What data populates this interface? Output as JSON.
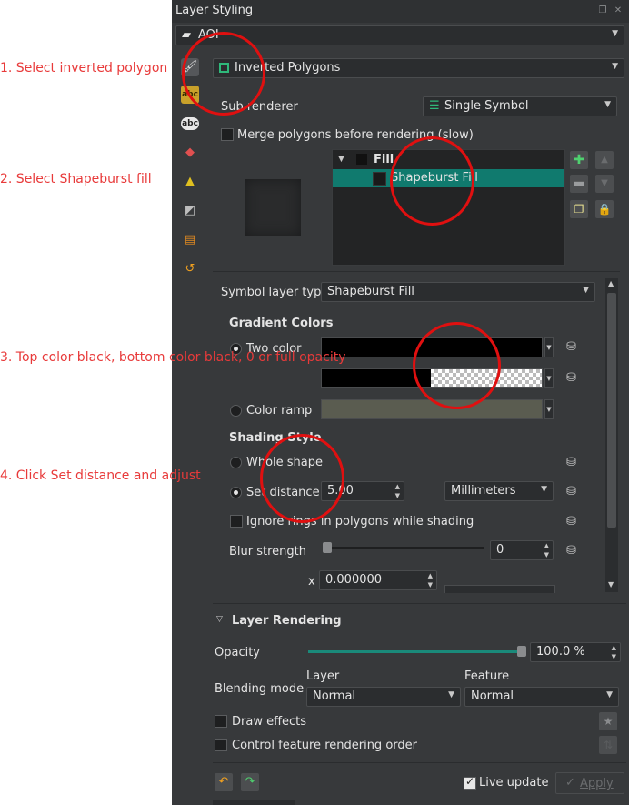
{
  "window": {
    "title": "Layer Styling"
  },
  "layer_selector": {
    "value": "AOI"
  },
  "renderer": {
    "value": "Inverted Polygons"
  },
  "sub_renderer": {
    "label": "Sub renderer",
    "value": "Single Symbol"
  },
  "merge_polygons": {
    "label": "Merge polygons before rendering (slow)",
    "checked": false
  },
  "symbol_tree": {
    "root": "Fill",
    "child": "Shapeburst Fill"
  },
  "symbol_layer_type": {
    "label": "Symbol layer type",
    "value": "Shapeburst Fill"
  },
  "gradient_colors": {
    "heading": "Gradient Colors",
    "two_color_label": "Two color",
    "two_color_selected": true,
    "color_ramp_label": "Color ramp",
    "top_color": "#000000",
    "bottom_color": "#000000"
  },
  "shading_style": {
    "heading": "Shading Style",
    "whole_shape_label": "Whole shape",
    "set_distance_label": "Set distance",
    "distance_value": "5.00",
    "distance_unit": "Millimeters",
    "ignore_rings_label": "Ignore rings in polygons while shading",
    "blur_label": "Blur strength",
    "blur_value": "0",
    "offset_x_label": "x",
    "offset_x_value": "0.000000"
  },
  "layer_rendering": {
    "heading": "Layer Rendering",
    "opacity_label": "Opacity",
    "opacity_value": "100.0 %",
    "opacity_fraction": 1.0,
    "blending_label": "Blending mode",
    "layer_col": "Layer",
    "feature_col": "Feature",
    "layer_blend": "Normal",
    "feature_blend": "Normal",
    "draw_effects_label": "Draw effects",
    "control_order_label": "Control feature rendering order"
  },
  "footer": {
    "live_update_label": "Live update",
    "live_update_checked": true,
    "apply_label": "Apply"
  },
  "annotations": {
    "a1": "1. Select inverted polygon",
    "a2": "2. Select Shapeburst fill",
    "a3": "3. Top color black, bottom color black, 0 or full opacity",
    "a4": "4. Click Set distance and adjust"
  },
  "colors": {
    "accent": "#1a8a7a",
    "annotation": "#e01010",
    "panel": "#37393b"
  },
  "icons": [
    "paintbrush-icon",
    "label-abc-icon",
    "abc-icon",
    "cube-icon",
    "3d-view-icon",
    "diagram-icon",
    "stack-icon",
    "history-icon",
    "lock-icon",
    "add-icon",
    "remove-icon",
    "up-arrow-icon",
    "down-arrow-icon",
    "duplicate-icon",
    "data-defined-icon",
    "undo-icon",
    "redo-icon",
    "star-icon"
  ]
}
